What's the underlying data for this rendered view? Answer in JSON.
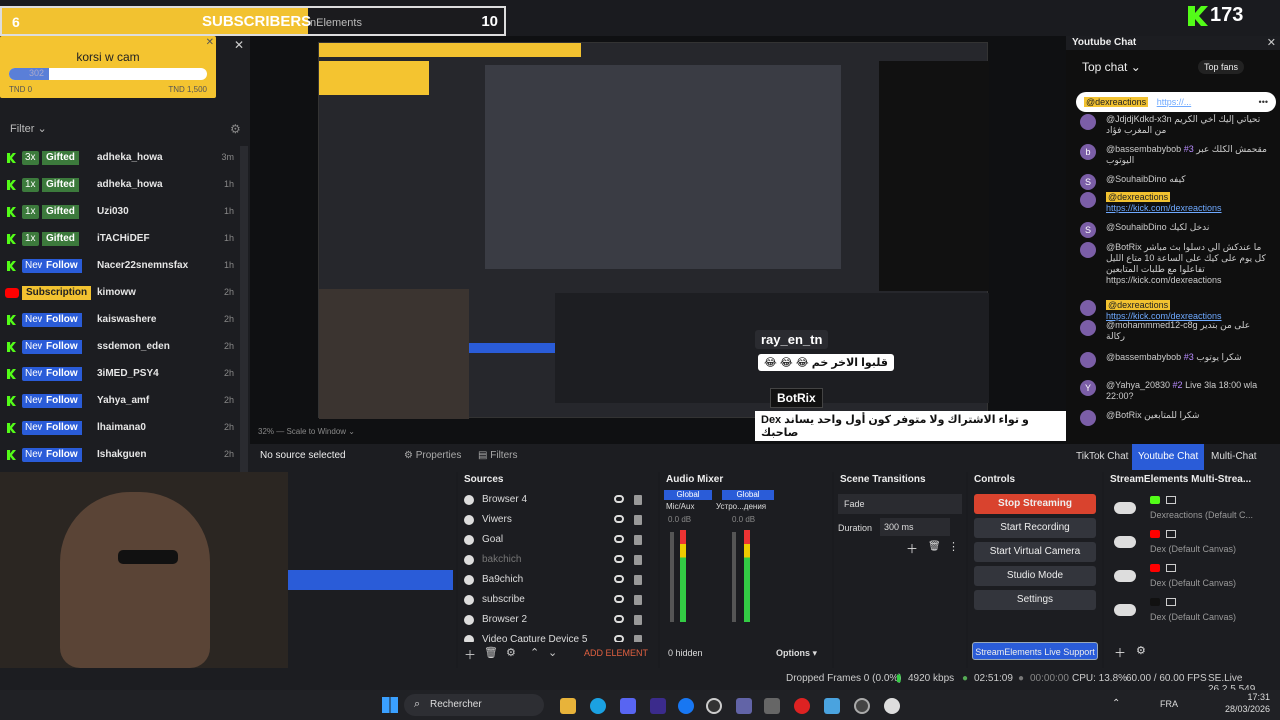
{
  "overlay": {
    "sub_count": "6",
    "sub_label": "SUBSCRIBERS",
    "sub_target": "10",
    "sub_ghost": "nElements",
    "goal_title": "korsi w cam",
    "goal_value": "302",
    "goal_min": "TND 0",
    "goal_max": "TND 1,500",
    "goal_progress": 0.2
  },
  "activity": {
    "filter_label": "Filter",
    "rows": [
      {
        "badge": "3x",
        "type": "Gifted",
        "name": "adheka_howa",
        "time": "3m"
      },
      {
        "badge": "1x",
        "type": "Gifted",
        "name": "adheka_howa",
        "time": "1h"
      },
      {
        "badge": "1x",
        "type": "Gifted",
        "name": "Uzi030",
        "time": "1h"
      },
      {
        "badge": "1x",
        "type": "Gifted",
        "name": "iTACHiDEF",
        "time": "1h"
      },
      {
        "badge": "New",
        "type": "Follow",
        "name": "Nacer22snemnsfax",
        "time": "1h"
      },
      {
        "badge": "",
        "type": "Subscription",
        "name": "kimoww",
        "time": "2h"
      },
      {
        "badge": "New",
        "type": "Follow",
        "name": "kaiswashere",
        "time": "2h"
      },
      {
        "badge": "New",
        "type": "Follow",
        "name": "ssdemon_eden",
        "time": "2h"
      },
      {
        "badge": "New",
        "type": "Follow",
        "name": "3iMED_PSY4",
        "time": "2h"
      },
      {
        "badge": "New",
        "type": "Follow",
        "name": "Yahya_amf",
        "time": "2h"
      },
      {
        "badge": "New",
        "type": "Follow",
        "name": "lhaimana0",
        "time": "2h"
      },
      {
        "badge": "New",
        "type": "Follow",
        "name": "Ishakguen",
        "time": "2h"
      }
    ]
  },
  "kick": {
    "count": "173"
  },
  "ytchat": {
    "title": "Youtube Chat",
    "mode": "Top chat",
    "top_fans": "Top fans",
    "pinned_user": "@dexreactions",
    "pinned_link": "https://...",
    "messages": [
      {
        "av": "",
        "user": "@JdjdjKdkd-x3n",
        "text": "تحياتي إليك أخي الكريم من المغرب فؤاد"
      },
      {
        "av": "b",
        "user": "@bassembabybob",
        "badge": "#3",
        "text": "مقحمش الكلك عبر اليوتوب"
      },
      {
        "av": "S",
        "user": "@SouhaibDino",
        "text": "كيفه"
      },
      {
        "av": "",
        "user": "@dexreactions",
        "text": "https://kick.com/dexreactions"
      },
      {
        "av": "S",
        "user": "@SouhaibDino",
        "text": "ندخل لكيك"
      },
      {
        "av": "",
        "user": "@BotRix",
        "text": "ما عندكش الي دسلوا بث مباشر كل يوم على كيك على الساعة 10 متاع الليل تفاعلوا مع طلبات المتابعين https://kick.com/dexreactions"
      },
      {
        "av": "",
        "user": "@dexreactions",
        "text": "https://kick.com/dexreactions"
      },
      {
        "av": "",
        "user": "@mohammmed12-c8g",
        "text": "على من بتدير ركالة"
      },
      {
        "av": "",
        "user": "@bassembabybob",
        "badge": "#3",
        "text": "شكرا يوتوب"
      },
      {
        "av": "Y",
        "user": "@Yahya_20830",
        "badge": "#2",
        "text": "Live 3la 18:00 wla 22:00?"
      },
      {
        "av": "",
        "user": "@BotRix",
        "text": "شكرا للمتابعين"
      }
    ],
    "tabs": [
      "TikTok Chat",
      "Youtube Chat",
      "Multi-Chat"
    ]
  },
  "obs": {
    "no_source": "No source selected",
    "properties": "Properties",
    "filters": "Filters",
    "sources_title": "Sources",
    "sources": [
      {
        "name": "Browser 4",
        "hidden": false
      },
      {
        "name": "Viwers",
        "hidden": false
      },
      {
        "name": "Goal",
        "hidden": false
      },
      {
        "name": "bakchich",
        "hidden": true
      },
      {
        "name": "Ba9chich",
        "hidden": false
      },
      {
        "name": "subscribe",
        "hidden": false
      },
      {
        "name": "Browser 2",
        "hidden": false
      },
      {
        "name": "Video Capture Device 5",
        "hidden": false
      }
    ],
    "add_element": "ADD ELEMENT",
    "mixer_title": "Audio Mixer",
    "mixer_ch1": "Global",
    "mixer_ch1_dev": "Mic/Aux",
    "mixer_ch2": "Global",
    "mixer_ch2_dev": "Устро...дения",
    "db1": "0.0 dB",
    "db2": "0.0 dB",
    "hidden": "0 hidden",
    "options": "Options",
    "transitions_title": "Scene Transitions",
    "fade": "Fade",
    "duration_label": "Duration",
    "duration": "300 ms",
    "controls_title": "Controls",
    "stop_streaming": "Stop Streaming",
    "start_recording": "Start Recording",
    "start_virtual": "Start Virtual Camera",
    "studio_mode": "Studio Mode",
    "settings": "Settings",
    "se_support": "StreamElements Live Support",
    "multistream_title": "StreamElements Multi-Strea...",
    "targets": [
      {
        "name": "Dexreactions (Default C..."
      },
      {
        "name": "Dex (Default Canvas)"
      },
      {
        "name": "Dex (Default Canvas)"
      },
      {
        "name": "Dex (Default Canvas)"
      }
    ],
    "zoom": "32%",
    "scale": "Scale to Window"
  },
  "status": {
    "dropped": "Dropped Frames 0 (0.0%)",
    "kbps": "4920 kbps",
    "live_time": "02:51:09",
    "rec_time": "00:00:00",
    "cpu": "CPU: 13.8%",
    "fps": "60.00 / 60.00 FPS",
    "version": "SE.Live 26.2.5.549"
  },
  "taskbar": {
    "search": "Rechercher",
    "lang": "FRA",
    "time": "17:31",
    "date": "28/03/2026"
  },
  "overlay_chat": {
    "user1": "ray_en_tn",
    "msg1": "😂 😂 😂 قلبوا الاخر خم",
    "user2": "BotRix",
    "msg2": "Dex و تواء الاشتراك ولا متوفر كون أول واحد يساند صاحبك"
  },
  "colors": {
    "accent": "#2a5cd8",
    "kick": "#53fc18",
    "goal": "#f4c430",
    "stop": "#d9432e"
  }
}
